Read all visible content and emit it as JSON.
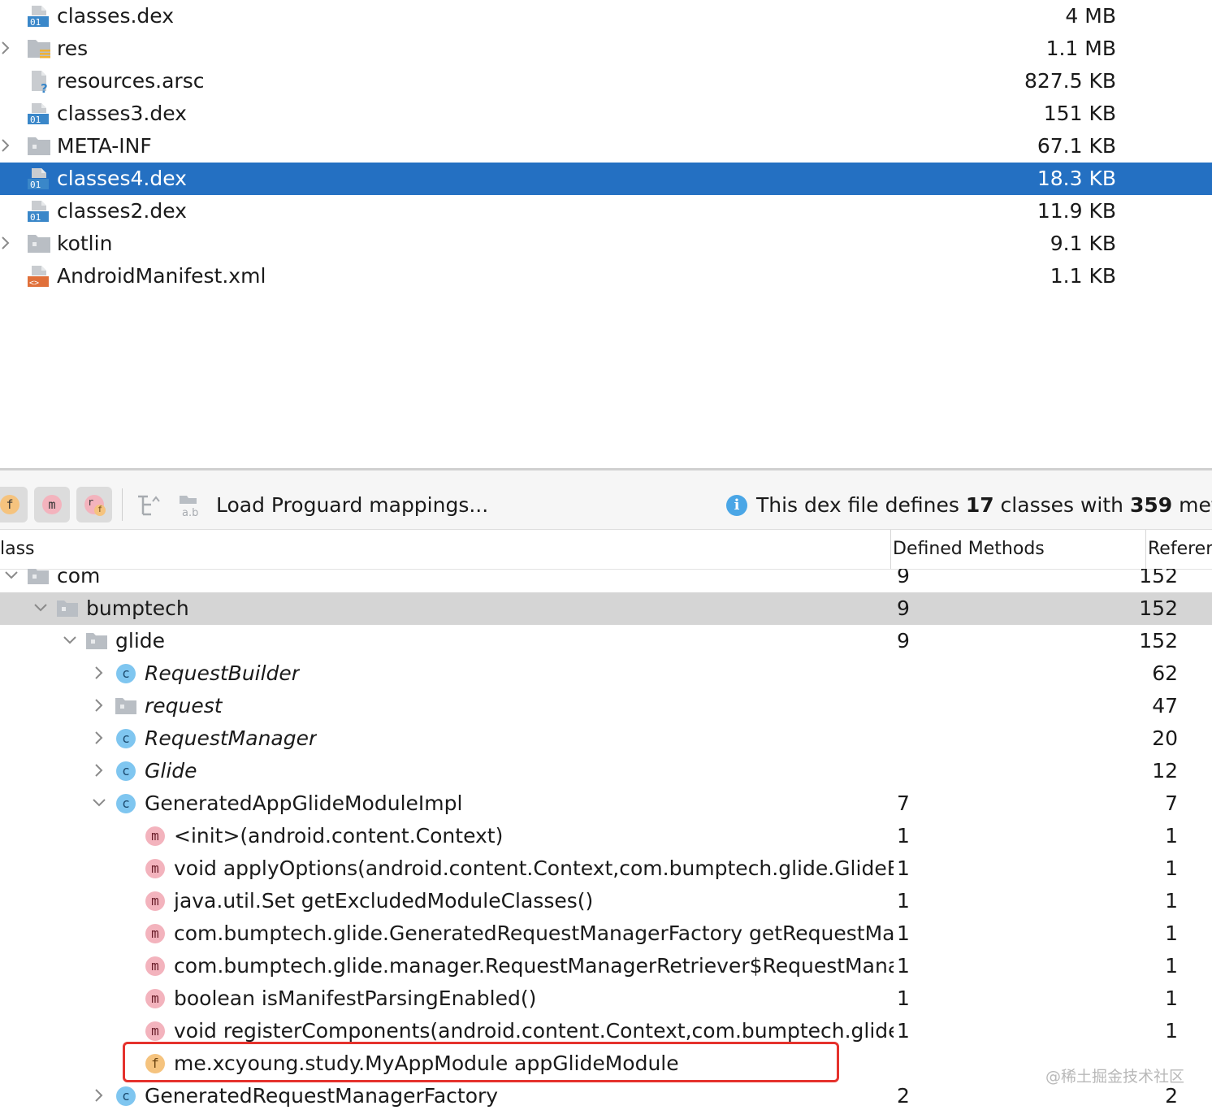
{
  "files": [
    {
      "name": "classes.dex",
      "size": "4 MB",
      "icon": "dex-file-icon",
      "expandable": false,
      "selected": false
    },
    {
      "name": "res",
      "size": "1.1 MB",
      "icon": "res-folder-icon",
      "expandable": true,
      "selected": false
    },
    {
      "name": "resources.arsc",
      "size": "827.5 KB",
      "icon": "arsc-file-icon",
      "expandable": false,
      "selected": false
    },
    {
      "name": "classes3.dex",
      "size": "151 KB",
      "icon": "dex-file-icon",
      "expandable": false,
      "selected": false
    },
    {
      "name": "META-INF",
      "size": "67.1 KB",
      "icon": "folder-icon",
      "expandable": true,
      "selected": false
    },
    {
      "name": "classes4.dex",
      "size": "18.3 KB",
      "icon": "dex-file-icon",
      "expandable": false,
      "selected": true
    },
    {
      "name": "classes2.dex",
      "size": "11.9 KB",
      "icon": "dex-file-icon",
      "expandable": false,
      "selected": false
    },
    {
      "name": "kotlin",
      "size": "9.1 KB",
      "icon": "folder-icon",
      "expandable": true,
      "selected": false
    },
    {
      "name": "AndroidManifest.xml",
      "size": "1.1 KB",
      "icon": "xml-file-icon",
      "expandable": false,
      "selected": false
    }
  ],
  "toolbar": {
    "filter_fields_badge": "f",
    "filter_methods_badge": "m",
    "filter_references_badge": "r",
    "load_proguard_label": "Load Proguard mappings...",
    "info_prefix": "This dex file defines ",
    "class_count": "17",
    "info_middle": " classes with ",
    "method_count": "359",
    "info_suffix": " met"
  },
  "columns": {
    "class": "lass",
    "defined_methods": "Defined Methods",
    "referenced": "Referen"
  },
  "tree": [
    {
      "label": "com",
      "type": "package",
      "chevron": "down",
      "defined": "9",
      "referenced": "152"
    },
    {
      "label": "bumptech",
      "type": "package",
      "chevron": "down",
      "defined": "9",
      "referenced": "152"
    },
    {
      "label": "glide",
      "type": "package",
      "chevron": "down",
      "defined": "9",
      "referenced": "152"
    },
    {
      "label": "RequestBuilder",
      "type": "class",
      "chevron": "right",
      "defined": "",
      "referenced": "62"
    },
    {
      "label": "request",
      "type": "package",
      "chevron": "right",
      "defined": "",
      "referenced": "47"
    },
    {
      "label": "RequestManager",
      "type": "class",
      "chevron": "right",
      "defined": "",
      "referenced": "20"
    },
    {
      "label": "Glide",
      "type": "class",
      "chevron": "right",
      "defined": "",
      "referenced": "12"
    },
    {
      "label": "GeneratedAppGlideModuleImpl",
      "type": "class",
      "chevron": "down",
      "defined": "7",
      "referenced": "7"
    },
    {
      "label": "<init>(android.content.Context)",
      "type": "method",
      "chevron": "",
      "defined": "1",
      "referenced": "1"
    },
    {
      "label": "void applyOptions(android.content.Context,com.bumptech.glide.GlideB",
      "type": "method",
      "chevron": "",
      "defined": "1",
      "referenced": "1"
    },
    {
      "label": "java.util.Set getExcludedModuleClasses()",
      "type": "method",
      "chevron": "",
      "defined": "1",
      "referenced": "1"
    },
    {
      "label": "com.bumptech.glide.GeneratedRequestManagerFactory getRequestMa",
      "type": "method",
      "chevron": "",
      "defined": "1",
      "referenced": "1"
    },
    {
      "label": "com.bumptech.glide.manager.RequestManagerRetriever$RequestMana",
      "type": "method",
      "chevron": "",
      "defined": "1",
      "referenced": "1"
    },
    {
      "label": "boolean isManifestParsingEnabled()",
      "type": "method",
      "chevron": "",
      "defined": "1",
      "referenced": "1"
    },
    {
      "label": "void registerComponents(android.content.Context,com.bumptech.glide",
      "type": "method",
      "chevron": "",
      "defined": "1",
      "referenced": "1"
    },
    {
      "label": "me.xcyoung.study.MyAppModule appGlideModule",
      "type": "field",
      "chevron": "",
      "defined": "",
      "referenced": ""
    },
    {
      "label": "GeneratedRequestManagerFactory",
      "type": "class",
      "chevron": "right",
      "defined": "2",
      "referenced": "2"
    }
  ],
  "badges": {
    "class": "c",
    "method": "m",
    "field": "f"
  },
  "watermark": "@稀土掘金技术社区",
  "colors": {
    "selection": "#2470c2",
    "row_highlight": "#d5d5d5",
    "class_badge": "#7fc6f0",
    "method_badge": "#f3b3bd",
    "field_badge": "#f5c37e",
    "annotation_box": "#e5322d"
  }
}
